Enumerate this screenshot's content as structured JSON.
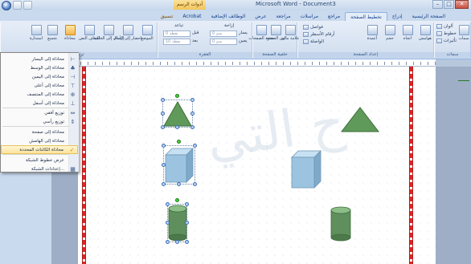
{
  "window": {
    "title": "Microsoft Word - Document3",
    "context_tab_title": "أدوات الرسم",
    "controls": [
      "–",
      "□",
      "✕"
    ]
  },
  "tabs": [
    {
      "label": "الصفحة الرئيسية",
      "active": false
    },
    {
      "label": "إدراج",
      "active": false
    },
    {
      "label": "تخطيط الصفحة",
      "active": true
    },
    {
      "label": "مراجع",
      "active": false
    },
    {
      "label": "مراسلات",
      "active": false
    },
    {
      "label": "مراجعة",
      "active": false
    },
    {
      "label": "عرض",
      "active": false
    },
    {
      "label": "الوظائف الإضافية",
      "active": false
    },
    {
      "label": "Acrobat",
      "active": false
    },
    {
      "label": "تنسيق",
      "active": false,
      "context": true
    }
  ],
  "ribbon": {
    "groups": {
      "themes": "سمات",
      "page_setup": "إعداد الصفحة",
      "page_background": "خلفية الصفحة",
      "paragraph": "الفقرة",
      "arrange": "ترتيب"
    },
    "buttons": {
      "themes": "سمات",
      "margins": "هوامش",
      "orientation": "اتجاه",
      "size": "حجم",
      "columns": "أعمدة",
      "watermark": "علامة مائية",
      "page_color": "لون الصفحة",
      "page_borders": "حدود الصفحات",
      "position": "الموضع",
      "bring_to_front": "إحضار إلى الأمام",
      "send_to_back": "إرسال إلى الخلفية",
      "text_wrapping": "التفاف النص",
      "align": "محاذاة",
      "group": "تجميع",
      "rotate": "استدارة"
    },
    "small": {
      "colors": "ألوان",
      "fonts": "خطوط",
      "effects": "تأثيرات",
      "breaks": "فواصل",
      "line_numbers": "أرقام الأسطر",
      "hyphenation": "الواصلة",
      "indent_label": "إزاحة",
      "spacing_label": "تباعد",
      "left": "يسار",
      "right": "يمين",
      "before": "قبل",
      "after": "بعد",
      "spin_value_left": "0 سم",
      "spin_value_right": "0 سم",
      "spin_value_before": "0 نقطة",
      "spin_value_after": "10 نقطة"
    }
  },
  "align_menu": {
    "items": [
      {
        "label": "محاذاة إلى اليسار",
        "icon": "align-left-icon",
        "glyph": "⊢"
      },
      {
        "label": "محاذاة إلى الوسط",
        "icon": "align-center-icon",
        "glyph": "♣"
      },
      {
        "label": "محاذاة إلى اليمين",
        "icon": "align-right-icon",
        "glyph": "⊣"
      },
      {
        "label": "محاذاة إلى أعلى",
        "icon": "align-top-icon",
        "glyph": "⊤"
      },
      {
        "label": "محاذاة إلى المنتصف",
        "icon": "align-middle-icon",
        "glyph": "⊕"
      },
      {
        "label": "محاذاة إلى أسفل",
        "icon": "align-bottom-icon",
        "glyph": "⊥"
      },
      {
        "label": "توزيع أفقي",
        "icon": "distribute-horizontal-icon",
        "glyph": "⇔"
      },
      {
        "label": "توزيع رأسي",
        "icon": "distribute-vertical-icon",
        "glyph": "⇕"
      },
      {
        "label": "محاذاة إلى صفحة",
        "icon": "",
        "glyph": ""
      },
      {
        "label": "محاذاة إلى الهامش",
        "icon": "",
        "glyph": ""
      },
      {
        "label": "محاذاة الكائنات المحددة",
        "icon": "checkmark-icon",
        "glyph": "✓",
        "checked": true
      },
      {
        "label": "عرض خطوط الشبكة",
        "icon": "",
        "glyph": ""
      },
      {
        "label": "إعدادات الشبكة...",
        "icon": "grid-settings-icon",
        "glyph": "▦"
      }
    ]
  },
  "document": {
    "watermark": "ح التي",
    "colors": {
      "triangle": "#5f9a5a",
      "cube_face": "#9cc4e0",
      "cylinder": "#5e8f5c",
      "margin_line": "#e02424"
    }
  }
}
